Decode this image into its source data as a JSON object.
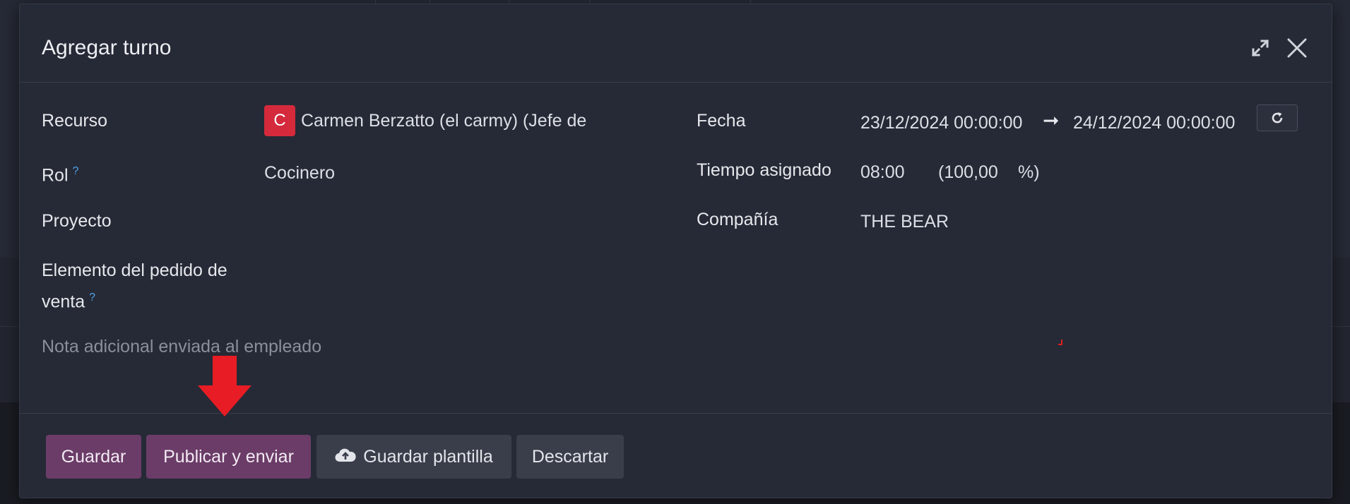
{
  "modal": {
    "title": "Agregar turno",
    "expand_icon": "expand-icon",
    "close_icon": "close-icon"
  },
  "form": {
    "recurso": {
      "label": "Recurso",
      "avatar_letter": "C",
      "value": "Carmen Berzatto (el carmy) (Jefe de"
    },
    "rol": {
      "label": "Rol",
      "help": "?",
      "value": "Cocinero"
    },
    "proyecto": {
      "label": "Proyecto",
      "value": ""
    },
    "elemento": {
      "label_line1": "Elemento del pedido de",
      "label_line2": "venta",
      "help": "?"
    },
    "fecha": {
      "label": "Fecha",
      "start": "23/12/2024 00:00:00",
      "arrow": "➞",
      "end": "24/12/2024 00:00:00"
    },
    "tiempo": {
      "label": "Tiempo asignado",
      "hours": "08:00",
      "percent": "(100,00",
      "percent_sign": "%)"
    },
    "compania": {
      "label": "Compañía",
      "value": "THE BEAR"
    },
    "nota_placeholder": "Nota adicional enviada al empleado"
  },
  "footer": {
    "save_label": "Guardar",
    "publish_label": "Publicar y enviar",
    "template_label": "Guardar plantilla",
    "discard_label": "Descartar"
  },
  "colors": {
    "primary_button": "#6b3c68",
    "avatar": "#d42a3c",
    "help": "#4fa3e6",
    "annotation_arrow": "#e81c24"
  }
}
